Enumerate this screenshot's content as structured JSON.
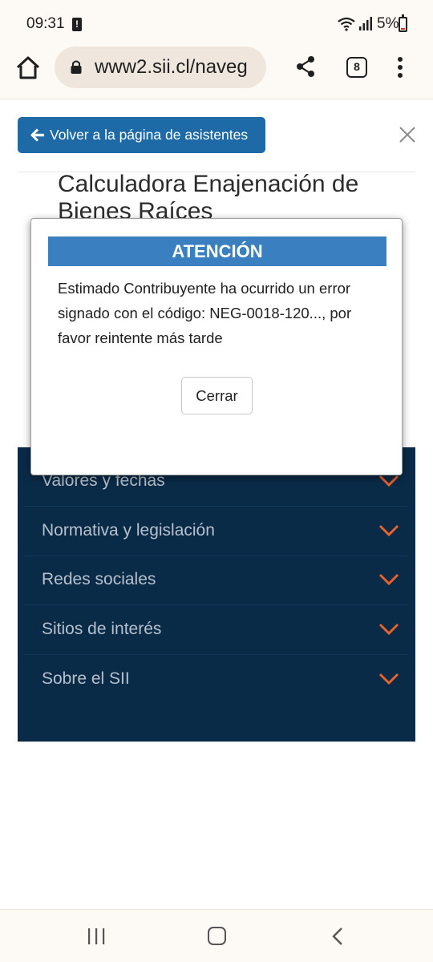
{
  "status_bar": {
    "time": "09:31",
    "battery": "5%"
  },
  "browser": {
    "url": "www2.sii.cl/naveg",
    "tab_count": "8"
  },
  "page": {
    "back_button_label": "Volver a la página de asistentes",
    "title": "Calculadora Enajenación de Bienes Raíces"
  },
  "footer": {
    "items": [
      {
        "label": "Valores y fechas"
      },
      {
        "label": "Normativa y legislación"
      },
      {
        "label": "Redes sociales"
      },
      {
        "label": "Sitios de interés"
      },
      {
        "label": "Sobre el SII"
      }
    ]
  },
  "modal": {
    "title": "ATENCIÓN",
    "message": "Estimado Contribuyente ha ocurrido un error signado con el código: NEG-0018-120..., por favor reintente más tarde",
    "close_label": "Cerrar"
  },
  "colors": {
    "primary_button": "#1d6aa6",
    "modal_header": "#3a7fc0",
    "footer_bg": "#0a2b48",
    "chevron": "#e8622c"
  }
}
